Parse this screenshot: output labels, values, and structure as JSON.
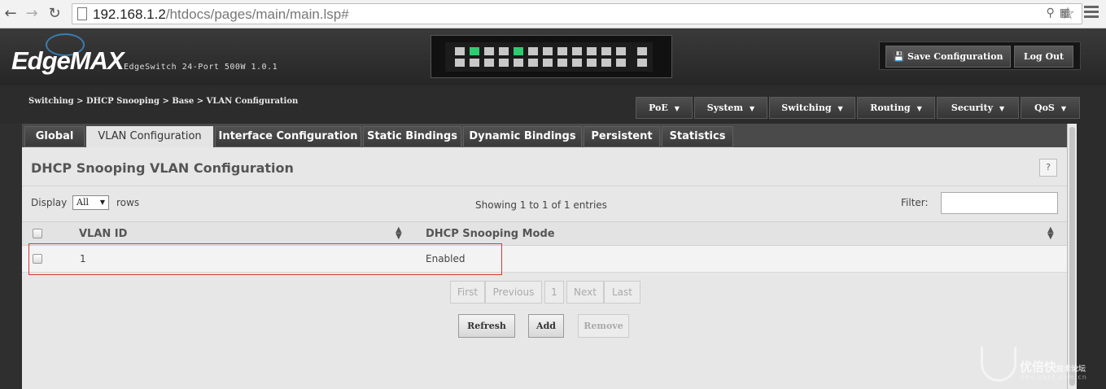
{
  "browser": {
    "url_host": "192.168.1.2",
    "url_path": "/htdocs/pages/main/main.lsp#"
  },
  "header": {
    "logo": "EdgeMAX",
    "logo_tm": "™",
    "model": "EdgeSwitch 24-Port 500W 1.0.1",
    "save_label": "Save Configuration",
    "logout_label": "Log Out"
  },
  "breadcrumb": "Switching > DHCP Snooping > Base > VLAN Configuration",
  "menus": [
    {
      "label": "PoE"
    },
    {
      "label": "System"
    },
    {
      "label": "Switching"
    },
    {
      "label": "Routing"
    },
    {
      "label": "Security"
    },
    {
      "label": "QoS"
    }
  ],
  "tabs": [
    {
      "label": "Global"
    },
    {
      "label": "VLAN Configuration"
    },
    {
      "label": "Interface Configuration"
    },
    {
      "label": "Static Bindings"
    },
    {
      "label": "Dynamic Bindings"
    },
    {
      "label": "Persistent"
    },
    {
      "label": "Statistics"
    }
  ],
  "panel": {
    "title": "DHCP Snooping VLAN Configuration",
    "help": "?",
    "display_label": "Display",
    "rows_value": "All",
    "rows_label": "rows",
    "showing": "Showing 1 to 1 of 1 entries",
    "filter_label": "Filter:"
  },
  "table": {
    "columns": [
      "VLAN ID",
      "DHCP Snooping Mode"
    ],
    "rows": [
      {
        "vlan_id": "1",
        "mode": "Enabled"
      }
    ]
  },
  "pager": {
    "first": "First",
    "previous": "Previous",
    "page": "1",
    "next": "Next",
    "last": "Last"
  },
  "actions": {
    "refresh": "Refresh",
    "add": "Add",
    "remove": "Remove"
  },
  "watermark": {
    "name": "优倍快",
    "sub": "技术论坛",
    "url": "bbs.ubnt.com.cn"
  },
  "colors": {
    "active_port": "#2ecc71",
    "highlight": "#d23a3a"
  }
}
